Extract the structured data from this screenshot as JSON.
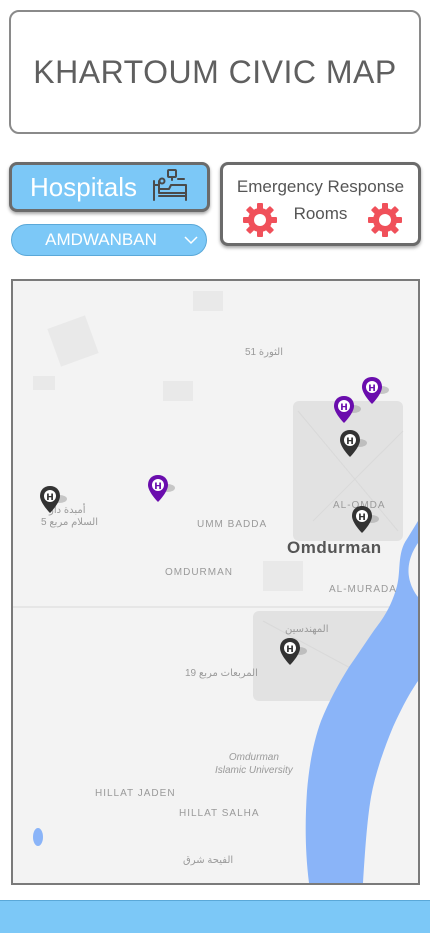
{
  "header": {
    "title": "KHARTOUM CIVIC MAP"
  },
  "hospitals_button": {
    "label": "Hospitals",
    "icon": "hospital-bed-icon"
  },
  "area_dropdown": {
    "selected": "AMDWANBAN",
    "icon": "chevron-down-icon"
  },
  "emergency_button": {
    "label_line1": "Emergency Response",
    "label_line2": "Rooms",
    "icon": "gear-icon",
    "icon_color": "#f0505a"
  },
  "map": {
    "labels": {
      "umm_badda": "UMM BADDA",
      "omdurman_small": "OMDURMAN",
      "omdurman_city": "Omdurman",
      "al_omda": "AL-OMDA",
      "al_murada": "AL-MURADA",
      "hillat_jaden": "HILLAT JADEN",
      "hillat_salha": "HILLAT SALHA",
      "university_line1": "Omdurman",
      "university_line2": "Islamic University",
      "ar_thawra": "الثورة 51",
      "ar_muhandiseen": "المهندسين",
      "ar_murabbaat": "المربعات مربع 19",
      "ar_umbeda": "أمبدة دار",
      "ar_salam": "السلام مربع 5",
      "ar_sharq": "الفيحة شرق"
    },
    "pins": [
      {
        "type": "hospital",
        "color": "#6a0dad"
      },
      {
        "type": "hospital",
        "color": "#6a0dad"
      },
      {
        "type": "hospital",
        "color": "#333333"
      },
      {
        "type": "hospital",
        "color": "#6a0dad"
      },
      {
        "type": "hospital",
        "color": "#333333"
      },
      {
        "type": "hospital",
        "color": "#333333"
      },
      {
        "type": "hospital",
        "color": "#333333"
      }
    ],
    "pin_letter": "H"
  },
  "colors": {
    "accent": "#7cc8f7",
    "border": "#6b6b6b",
    "river": "#8ab4f8"
  }
}
